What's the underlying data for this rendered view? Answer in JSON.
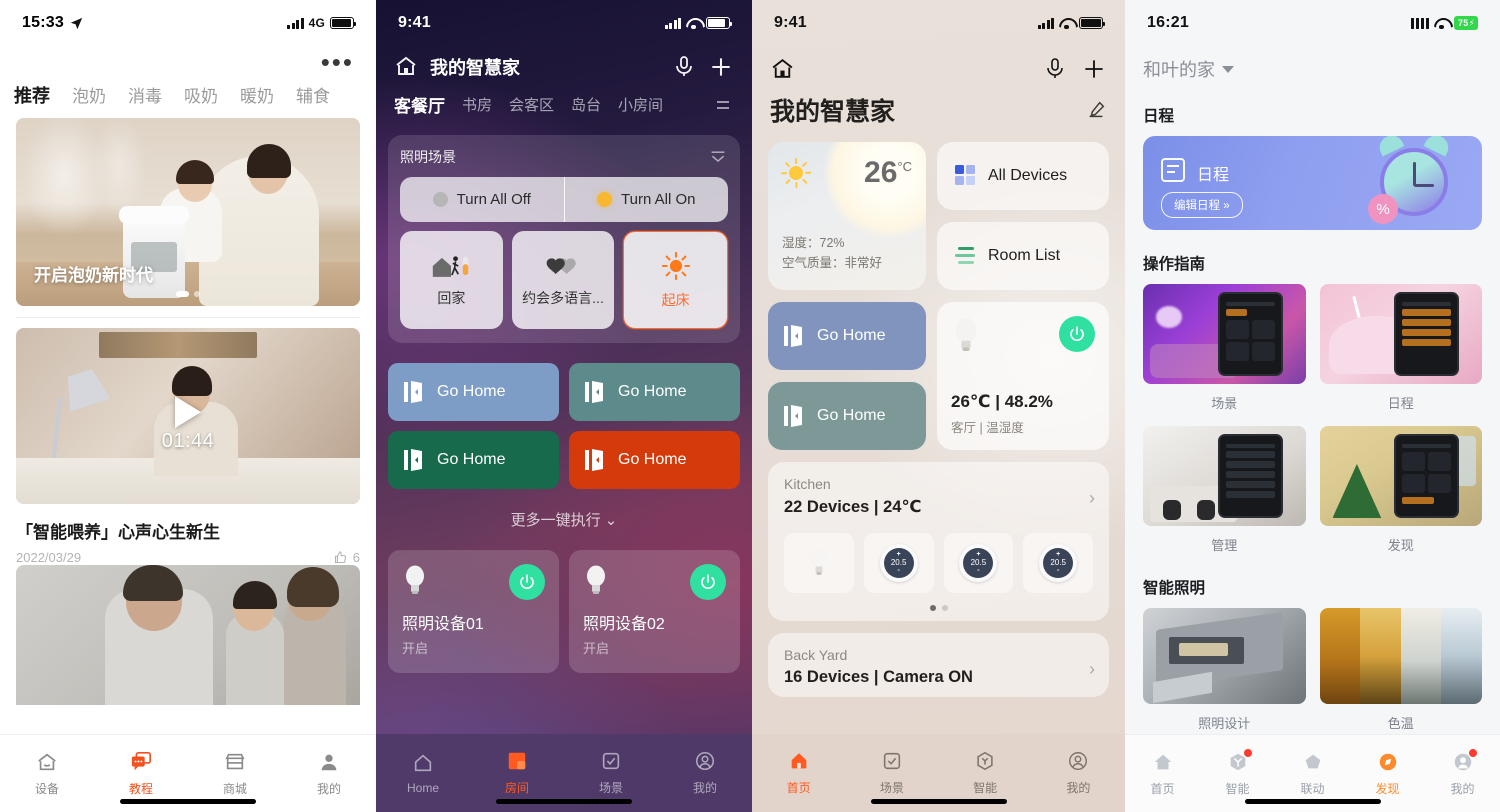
{
  "panel1": {
    "status": {
      "time": "15:33",
      "location_icon": "location-arrow-icon",
      "network": "4G"
    },
    "more_icon": "more-horizontal-icon",
    "tabs": [
      {
        "label": "推荐",
        "active": true
      },
      {
        "label": "泡奶",
        "active": false
      },
      {
        "label": "消毒",
        "active": false
      },
      {
        "label": "吸奶",
        "active": false
      },
      {
        "label": "暖奶",
        "active": false
      },
      {
        "label": "辅食",
        "active": false
      }
    ],
    "hero": {
      "caption": "开启泡奶新时代"
    },
    "video": {
      "duration": "01:44"
    },
    "article": {
      "title": "「智能喂养」心声心生新生",
      "date": "2022/03/29",
      "likes": "6"
    },
    "tabbar": [
      {
        "label": "设备",
        "icon": "home-icon",
        "active": false
      },
      {
        "label": "教程",
        "icon": "chat-bubbles-icon",
        "active": true
      },
      {
        "label": "商城",
        "icon": "store-icon",
        "active": false
      },
      {
        "label": "我的",
        "icon": "person-icon",
        "active": false
      }
    ]
  },
  "panel2": {
    "status": {
      "time": "9:41"
    },
    "header": {
      "title": "我的智慧家",
      "home_icon": "home-icon",
      "mic_icon": "microphone-icon",
      "add_icon": "plus-icon"
    },
    "rooms": [
      {
        "label": "客餐厅",
        "active": true
      },
      {
        "label": "书房",
        "active": false
      },
      {
        "label": "会客区",
        "active": false
      },
      {
        "label": "岛台",
        "active": false
      },
      {
        "label": "小房间",
        "active": false
      }
    ],
    "rooms_menu_icon": "list-menu-icon",
    "scene_card": {
      "title": "照明场景",
      "collapse_icon": "chevron-stack-down-icon",
      "turn_all_off": "Turn All Off",
      "turn_all_on": "Turn All On",
      "tiles": [
        {
          "label": "回家",
          "icon": "person-walking-home-icon",
          "selected": false
        },
        {
          "label": "约会多语言...",
          "icon": "hearts-icon",
          "selected": false
        },
        {
          "label": "起床",
          "icon": "sun-icon",
          "selected": true
        }
      ]
    },
    "go_buttons": [
      {
        "label": "Go Home",
        "color": "#7e9dc6"
      },
      {
        "label": "Go Home",
        "color": "#5d8a8a"
      },
      {
        "label": "Go Home",
        "color": "#186a4d"
      },
      {
        "label": "Go Home",
        "color": "#d43a0a"
      }
    ],
    "more_exec": "更多一键执行",
    "devices": [
      {
        "name": "照明设备01",
        "state": "开启",
        "icon": "bulb-icon",
        "power_icon": "power-icon"
      },
      {
        "name": "照明设备02",
        "state": "开启",
        "icon": "bulb-icon",
        "power_icon": "power-icon"
      }
    ],
    "tabbar": [
      {
        "label": "Home",
        "icon": "home-icon",
        "active": false
      },
      {
        "label": "房间",
        "icon": "rooms-icon",
        "active": true
      },
      {
        "label": "场景",
        "icon": "checkbox-icon",
        "active": false
      },
      {
        "label": "我的",
        "icon": "person-circle-icon",
        "active": false
      }
    ]
  },
  "panel3": {
    "status": {
      "time": "9:41"
    },
    "header": {
      "home_icon": "home-icon",
      "mic_icon": "microphone-icon",
      "add_icon": "plus-icon"
    },
    "title": "我的智慧家",
    "edit_icon": "pencil-icon",
    "weather": {
      "icon": "sun-icon",
      "temperature": "26",
      "unit": "°C",
      "humidity": "湿度：72%",
      "air_quality": "空气质量：非常好"
    },
    "all_devices": {
      "label": "All Devices",
      "icon": "grid-squares-icon"
    },
    "room_list": {
      "label": "Room List",
      "icon": "list-lines-icon"
    },
    "go_buttons": [
      {
        "label": "Go Home",
        "color": "#8194bd"
      },
      {
        "label": "Go Home",
        "color": "#7d9997"
      }
    ],
    "sensor": {
      "icon": "bulb-icon",
      "power_icon": "power-icon",
      "value": "26℃ | 48.2%",
      "sub": "客厅 | 温湿度"
    },
    "rooms": [
      {
        "name": "Kitchen",
        "stat": "22 Devices | 24℃",
        "devices": [
          {
            "type": "bulb",
            "value": ""
          },
          {
            "type": "knob",
            "value": "20.5"
          },
          {
            "type": "knob",
            "value": "20.5"
          },
          {
            "type": "knob",
            "value": "20.5"
          }
        ],
        "pages": 2,
        "active_page": 0
      },
      {
        "name": "Back Yard",
        "stat": "16 Devices | Camera ON",
        "devices": [],
        "pages": 0,
        "active_page": 0
      }
    ],
    "tabbar": [
      {
        "label": "首页",
        "icon": "home-icon",
        "active": true
      },
      {
        "label": "场景",
        "icon": "checkbox-icon",
        "active": false
      },
      {
        "label": "智能",
        "icon": "hexagon-y-icon",
        "active": false
      },
      {
        "label": "我的",
        "icon": "person-circle-icon",
        "active": false
      }
    ]
  },
  "panel4": {
    "status": {
      "time": "16:21",
      "battery": "75"
    },
    "home_selector": {
      "label": "和叶的家",
      "caret_icon": "caret-down-icon"
    },
    "sections": [
      {
        "title": "日程",
        "type": "banner",
        "banner": {
          "label": "日程",
          "icon": "calendar-icon",
          "button": "编辑日程 »",
          "art": "alarm-clock-icon"
        }
      },
      {
        "title": "操作指南",
        "type": "grid",
        "cards": [
          {
            "caption": "场景",
            "theme": "purple"
          },
          {
            "caption": "日程",
            "theme": "pink"
          },
          {
            "caption": "管理",
            "theme": "kitchen"
          },
          {
            "caption": "发现",
            "theme": "xmas"
          }
        ]
      },
      {
        "title": "智能照明",
        "type": "grid",
        "cards": [
          {
            "caption": "照明设计",
            "theme": "floorplan"
          },
          {
            "caption": "色温",
            "theme": "colortemp"
          }
        ]
      }
    ],
    "tabbar": [
      {
        "label": "首页",
        "icon": "home-icon",
        "active": false,
        "badge": false
      },
      {
        "label": "智能",
        "icon": "smart-icon",
        "active": false,
        "badge": true
      },
      {
        "label": "联动",
        "icon": "pentagon-icon",
        "active": false,
        "badge": false
      },
      {
        "label": "发现",
        "icon": "compass-icon",
        "active": true,
        "badge": false
      },
      {
        "label": "我的",
        "icon": "person-icon",
        "active": false,
        "badge": true
      }
    ]
  }
}
